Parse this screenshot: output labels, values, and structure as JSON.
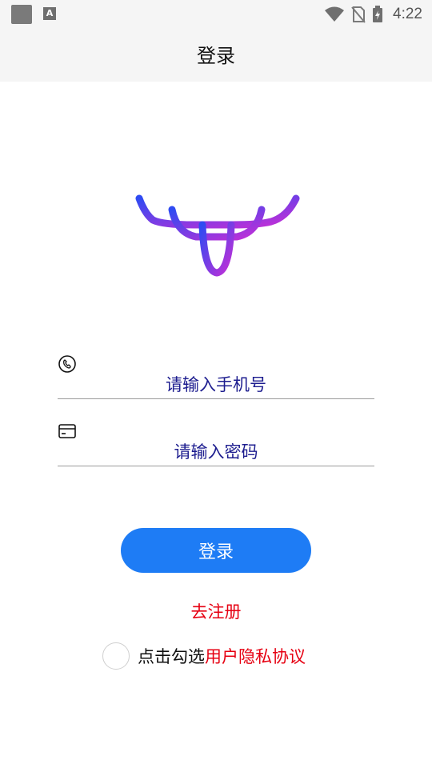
{
  "status_bar": {
    "time": "4:22",
    "icons": [
      "notification-square-icon",
      "keyboard-a-icon",
      "wifi-icon",
      "no-sim-icon",
      "battery-charging-icon"
    ],
    "notification_letter": "A"
  },
  "app_bar": {
    "title": "登录"
  },
  "logo": {
    "icon": "antlers-logo-icon",
    "gradient": [
      "#2f4bf2",
      "#c42fd6"
    ]
  },
  "form": {
    "phone": {
      "icon": "phone-icon",
      "placeholder": "请输入手机号",
      "value": ""
    },
    "password": {
      "icon": "card-icon",
      "placeholder": "请输入密码",
      "value": ""
    }
  },
  "login_button": {
    "label": "登录",
    "color": "#1e7cf5"
  },
  "register_link": {
    "label": "去注册",
    "color": "#e60012"
  },
  "agreement": {
    "checked": false,
    "prefix": "点击勾选",
    "link": "用户隐私协议"
  }
}
